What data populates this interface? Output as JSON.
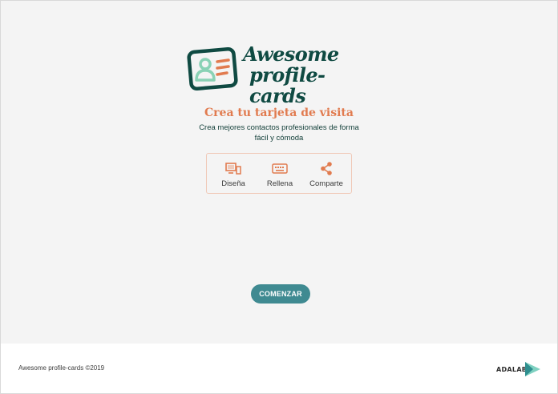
{
  "logo": {
    "line1": "Awesome",
    "line2": "profile-cards",
    "colors": {
      "card": "#0f4a42",
      "person": "#8ad2b5",
      "lines": "#e17b4f"
    }
  },
  "hero": {
    "headline": "Crea tu tarjeta de visita",
    "subtitle": "Crea mejores contactos profesionales de forma fácil y cómoda"
  },
  "steps": [
    {
      "label": "Diseña",
      "icon": "design-icon"
    },
    {
      "label": "Rellena",
      "icon": "keyboard-icon"
    },
    {
      "label": "Comparte",
      "icon": "share-icon"
    }
  ],
  "cta": {
    "label": "COMENZAR"
  },
  "footer": {
    "copyright": "Awesome profile-cards ©2019",
    "brand": "ADALAB"
  },
  "colors": {
    "accent": "#e17b4f",
    "primary_button": "#3f8a91",
    "dark_green": "#0f4a42",
    "background": "#f4f4f4"
  }
}
